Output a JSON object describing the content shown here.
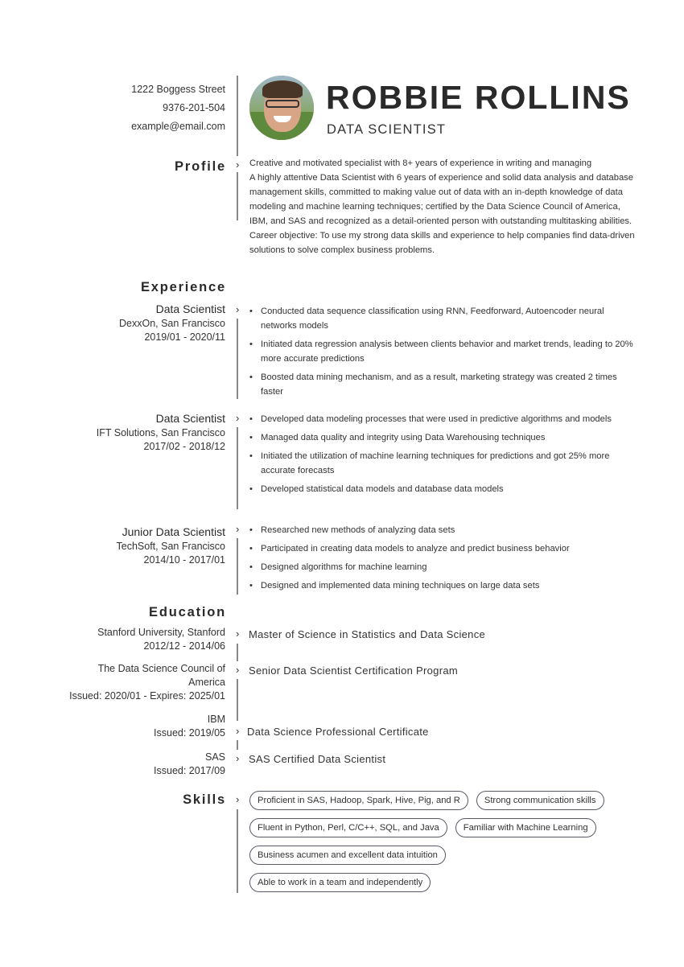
{
  "contact": {
    "address": "1222  Boggess Street",
    "phone": "9376-201-504",
    "email": "example@email.com"
  },
  "header": {
    "name": "ROBBIE ROLLINS",
    "title": "DATA SCIENTIST"
  },
  "profile": {
    "heading": "Profile",
    "paragraphs": [
      "Creative and motivated specialist with 8+ years of experience in writing and managing",
      "A highly attentive Data Scientist with 6 years of experience and solid data analysis and database management skills, committed to making value out of data with an in-depth knowledge of data modeling and machine learning techniques; certified by the Data Science Council of America, IBM, and SAS and recognized as a detail-oriented person with outstanding multitasking abilities.",
      "Career objective: To use my strong data skills and experience to help companies find data-driven solutions to solve complex business problems."
    ]
  },
  "experience": {
    "heading": "Experience",
    "jobs": [
      {
        "title": "Data Scientist",
        "company": "DexxOn, San Francisco",
        "dates": "2019/01 - 2020/11",
        "bullets": [
          "Conducted data sequence classification using RNN, Feedforward, Autoencoder neural networks models",
          "Initiated data regression analysis between clients behavior and market trends, leading to 20% more accurate predictions",
          "Boosted data mining mechanism, and as a result, marketing strategy was created 2 times faster"
        ]
      },
      {
        "title": "Data Scientist",
        "company": "IFT Solutions, San Francisco",
        "dates": "2017/02 - 2018/12",
        "bullets": [
          "Developed data modeling processes that were used in predictive algorithms and models",
          "Managed data quality and integrity using Data Warehousing techniques",
          "Initiated the utilization of machine learning techniques for predictions and got 25% more accurate forecasts",
          "Developed statistical data models and database data models"
        ]
      },
      {
        "title": "Junior Data Scientist",
        "company": "TechSoft, San Francisco",
        "dates": "2014/10 - 2017/01",
        "bullets": [
          "Researched new methods of analyzing data sets",
          "Participated in creating data models to analyze and predict business behavior",
          "Designed algorithms for machine learning",
          "Designed and implemented data mining techniques on large data sets"
        ]
      }
    ]
  },
  "education": {
    "heading": "Education",
    "items": [
      {
        "institution": "Stanford University, Stanford",
        "dates": "2012/12 - 2014/06",
        "degree": "Master of Science in Statistics and Data Science"
      },
      {
        "institution_line1": "The Data Science Council of",
        "institution_line2": "America",
        "dates": "Issued: 2020/01 - Expires: 2025/01",
        "degree": "Senior Data Scientist Certification Program"
      },
      {
        "institution": "IBM",
        "dates": "Issued: 2019/05",
        "degree": "Data Science Professional Certificate"
      },
      {
        "institution": "SAS",
        "dates": "Issued: 2017/09",
        "degree": "SAS Certified Data Scientist"
      }
    ]
  },
  "skills": {
    "heading": "Skills",
    "rows": [
      [
        "Proficient in SAS, Hadoop, Spark, Hive, Pig, and R",
        "Strong communication skills"
      ],
      [
        "Fluent in Python, Perl, C/C++, SQL, and Java",
        "Familiar with Machine Learning"
      ],
      [
        "Business acumen and excellent data intuition"
      ],
      [
        "Able to work in a team and independently"
      ]
    ]
  }
}
